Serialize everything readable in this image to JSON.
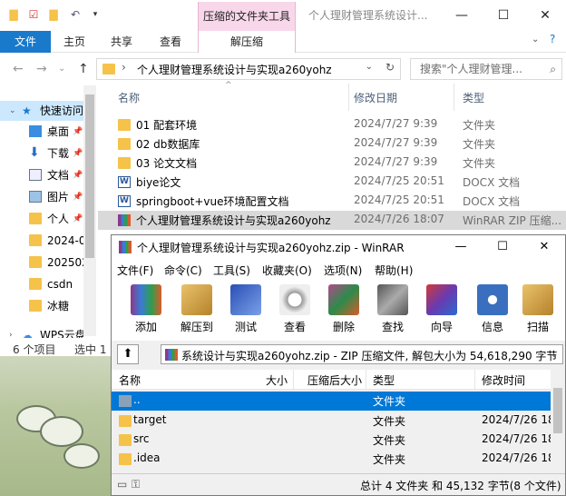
{
  "explorer": {
    "context_tab": "压缩的文件夹工具",
    "window_title": "个人理财管理系统设计...",
    "tabs": [
      "文件",
      "主页",
      "共享",
      "查看"
    ],
    "context_subtab": "解压缩",
    "address": "个人理财管理系统设计与实现a260yohz",
    "search_placeholder": "搜索\"个人理财管理...",
    "columns": {
      "name": "名称",
      "date": "修改日期",
      "type": "类型"
    },
    "nav_items": [
      "快速访问",
      "桌面",
      "下载",
      "文档",
      "图片",
      "个人",
      "2024-0",
      "202502",
      "csdn",
      "冰糖",
      "WPS云盘"
    ],
    "files": [
      {
        "name": "01 配套环境",
        "date": "2024/7/27 9:39",
        "type": "文件夹",
        "icon": "folder-icon"
      },
      {
        "name": "02 db数据库",
        "date": "2024/7/27 9:39",
        "type": "文件夹",
        "icon": "folder-icon"
      },
      {
        "name": "03 论文文档",
        "date": "2024/7/27 9:39",
        "type": "文件夹",
        "icon": "folder-icon"
      },
      {
        "name": "biye论文",
        "date": "2024/7/25 20:51",
        "type": "DOCX 文档",
        "icon": "word-icon"
      },
      {
        "name": "springboot+vue环境配置文档",
        "date": "2024/7/25 20:51",
        "type": "DOCX 文档",
        "icon": "word-icon"
      },
      {
        "name": "个人理财管理系统设计与实现a260yohz",
        "date": "2024/7/26 18:07",
        "type": "WinRAR ZIP 压缩...",
        "icon": "rar-icon"
      }
    ],
    "status_count": "6 个项目",
    "status_selected": "选中 1"
  },
  "winrar": {
    "title": "个人理财管理系统设计与实现a260yohz.zip - WinRAR",
    "menu": [
      "文件(F)",
      "命令(C)",
      "工具(S)",
      "收藏夹(O)",
      "选项(N)",
      "帮助(H)"
    ],
    "toolbar": [
      "添加",
      "解压到",
      "测试",
      "查看",
      "删除",
      "查找",
      "向导",
      "信息",
      "扫描"
    ],
    "path": "系统设计与实现a260yohz.zip - ZIP 压缩文件, 解包大小为 54,618,290 字节",
    "columns": {
      "name": "名称",
      "size": "大小",
      "packed": "压缩后大小",
      "type": "类型",
      "modified": "修改时间"
    },
    "rows": [
      {
        "name": "..",
        "type": "文件夹",
        "modified": ""
      },
      {
        "name": "target",
        "type": "文件夹",
        "modified": "2024/7/26 18"
      },
      {
        "name": "src",
        "type": "文件夹",
        "modified": "2024/7/26 18"
      },
      {
        "name": ".idea",
        "type": "文件夹",
        "modified": "2024/7/26 18"
      }
    ],
    "status": "总计 4 文件夹 和 45,132 字节(8 个文件)"
  },
  "colors": {
    "accent": "#1979ca",
    "context": "#f9d7eb",
    "folder": "#f5c24a",
    "selection": "#0078d7"
  }
}
